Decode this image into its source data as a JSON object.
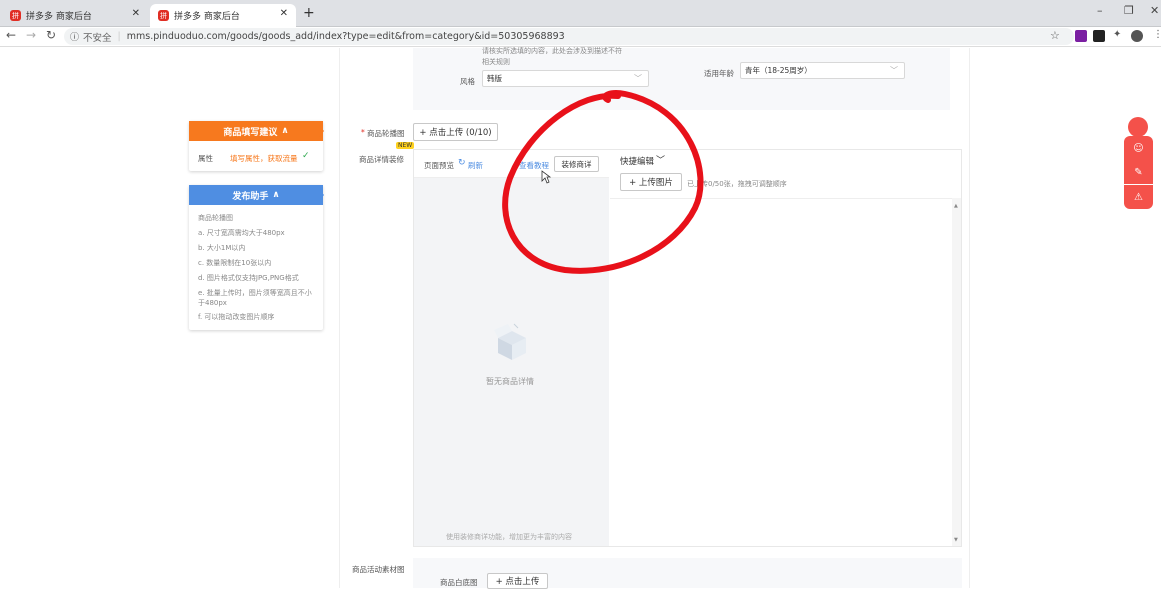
{
  "browser": {
    "tabs": [
      {
        "title": "拼多多 商家后台",
        "active": false
      },
      {
        "title": "拼多多 商家后台",
        "active": true
      }
    ],
    "new_tab": "+",
    "window_controls": [
      "–",
      "❐",
      "✕"
    ],
    "security_label": "不安全",
    "url": "mms.pinduoduo.com/goods/goods_add/index?type=edit&from=category&id=50305968893"
  },
  "top_form": {
    "note_line1": "请核实所选填的内容，此处会涉及到描述不符",
    "note_line2": "相关规则",
    "style_label": "风格",
    "style_value": "韩版",
    "age_label": "适用年龄",
    "age_value": "青年（18-25周岁）"
  },
  "suggest_card": {
    "title": "商品填写建议",
    "toggle_icon": "∧",
    "row_label": "属性",
    "row_value": "填写属性，获取流量",
    "check": "✓"
  },
  "helper_card": {
    "title": "发布助手",
    "toggle_icon": "∧",
    "heading": "商品轮播图",
    "items": [
      "a. 尺寸宽高需均大于480px",
      "b. 大小1M以内",
      "c. 数量限制在10张以内",
      "d. 图片格式仅支持JPG,PNG格式",
      "e. 批量上传时，图片须等宽高且不小于480px",
      "f. 可以拖动改变图片顺序"
    ]
  },
  "carousel": {
    "required_mark": "*",
    "label": "商品轮播图",
    "upload_button": "+ 点击上传 (0/10)"
  },
  "detail": {
    "label": "商品详情装修",
    "new_badge": "NEW",
    "preview_label": "页面预览",
    "refresh_label": "刷新",
    "tutorial_link": "查看教程",
    "decorate_button": "装修商详",
    "quick_edit": "快捷编辑",
    "upload_image": "+ 上传图片",
    "upload_hint": "已上传0/50张，拖拽可调整顺序",
    "empty_text": "暂无商品详情",
    "footer_hint": "使用装修商详功能，增加更为丰富的内容"
  },
  "activity": {
    "label": "商品活动素材图",
    "white_bg_label": "商品白底图",
    "upload_button": "+ 点击上传"
  },
  "colors": {
    "orange": "#f7791e",
    "blue": "#4f8ee2",
    "red_annotation": "#e8111a",
    "side_red": "#f4514a"
  }
}
